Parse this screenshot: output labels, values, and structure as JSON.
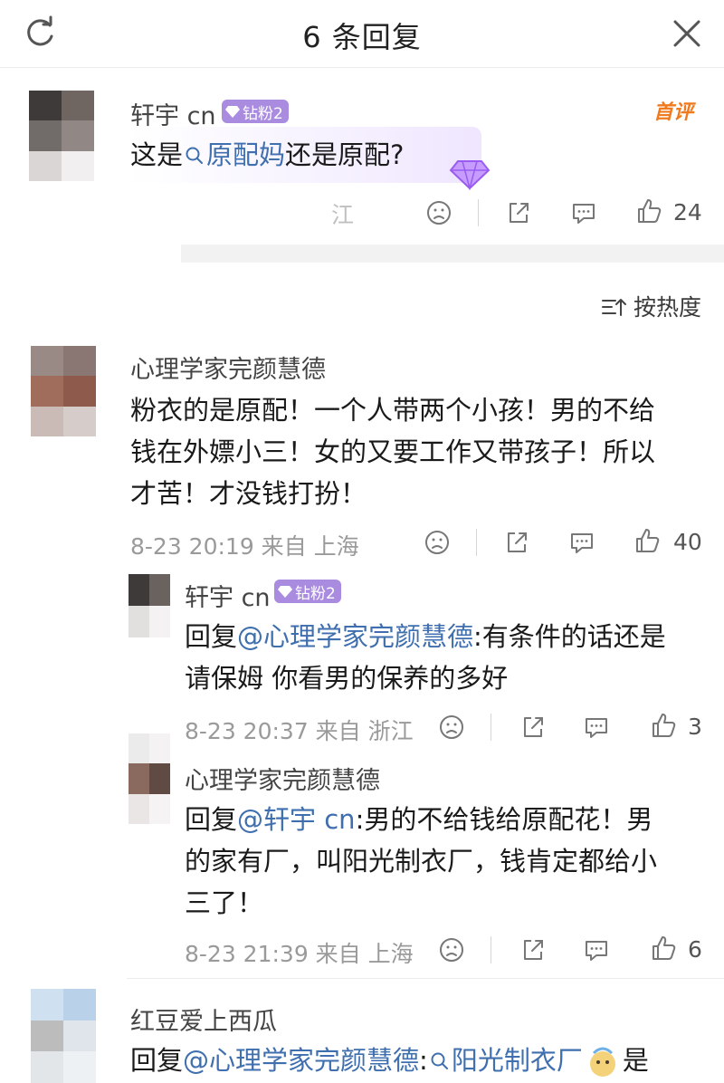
{
  "header": {
    "title": "6 条回复",
    "refresh_icon": "refresh-icon",
    "close_icon": "close-icon"
  },
  "main_comment": {
    "user": "轩宇 cn",
    "badge": "钻粉2",
    "tag": "首评",
    "text_prefix": "这是",
    "search_term": "原配妈",
    "text_suffix": "还是原配?",
    "location_partial": "江",
    "likes": "24"
  },
  "sort": {
    "label": "按热度"
  },
  "comments": [
    {
      "user": "心理学家完颜慧德",
      "lines": [
        "粉衣的是原配！一个人带两个小孩！男的不给",
        "钱在外嫖小三！女的又要工作又带孩子！所以",
        "才苦！才没钱打扮！"
      ],
      "time": "8-23 20:19 来自 上海",
      "likes": "40"
    }
  ],
  "replies": [
    {
      "user": "轩宇 cn",
      "badge": "钻粉2",
      "reply_prefix": "回复",
      "mention": "@心理学家完颜慧德",
      "line1": ":有条件的话还是",
      "line2": "请保姆 你看男的保养的多好",
      "time": "8-23 20:37 来自 浙江",
      "likes": "3"
    },
    {
      "user": "心理学家完颜慧德",
      "reply_prefix": "回复",
      "mention": "@轩宇 cn",
      "line1": ":男的不给钱给原配花！男",
      "line2": "的家有厂，叫阳光制衣厂，钱肯定都给小",
      "line3": "三了！",
      "time": "8-23 21:39 来自 上海",
      "likes": "6"
    }
  ],
  "last_comment": {
    "user": "红豆爱上西瓜",
    "reply_prefix": "回复",
    "mention": "@心理学家完颜慧德",
    "colon": ":",
    "search_term": "阳光制衣厂",
    "suffix": "是"
  },
  "colors": {
    "link": "#3f6fae",
    "badge": "#a98be0",
    "first_eval": "#f07a1e",
    "meta": "#9a9a9a"
  }
}
